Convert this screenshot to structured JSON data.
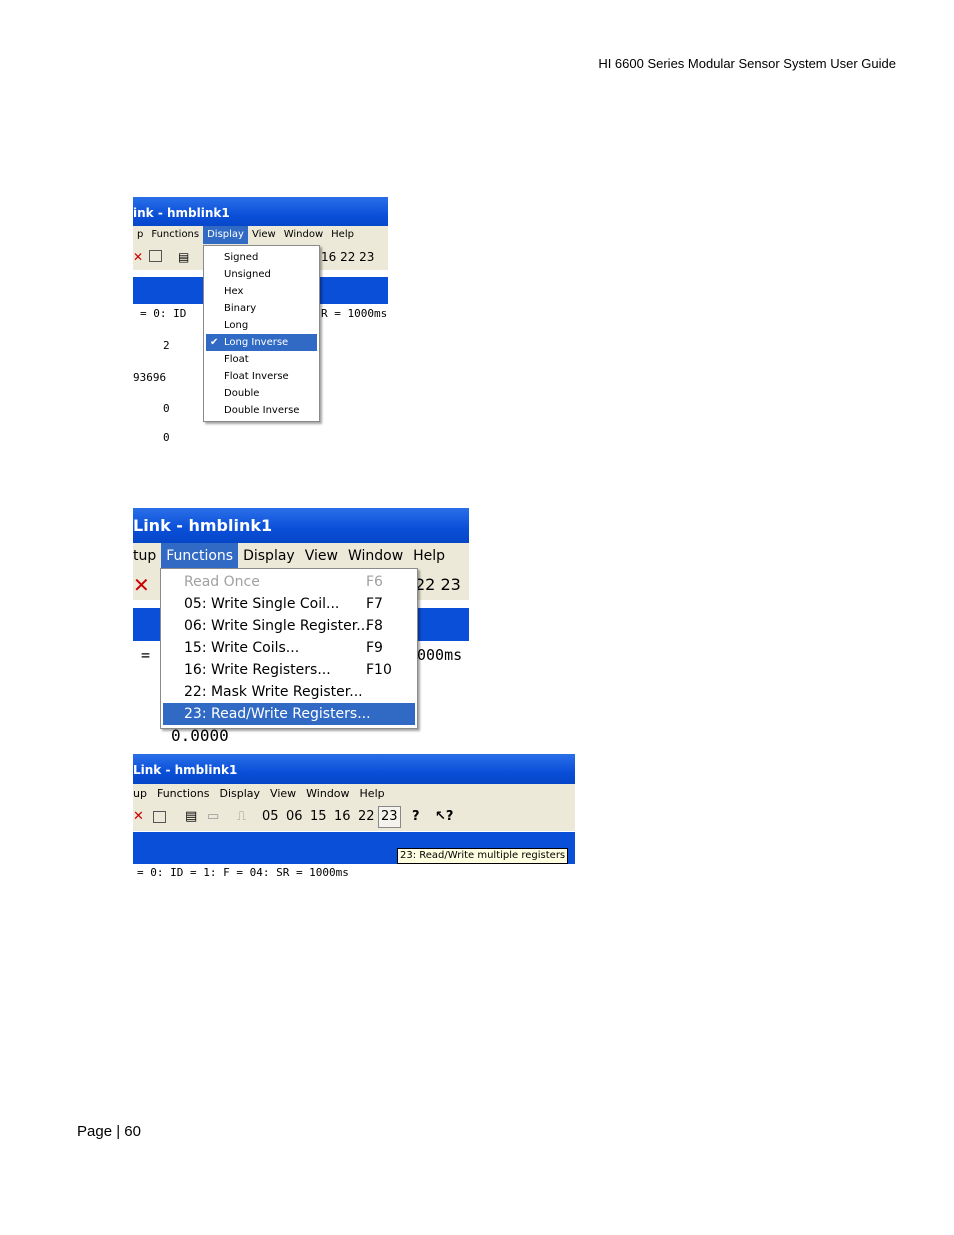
{
  "header": {
    "title": "HI 6600 Series Modular Sensor System User Guide"
  },
  "footer": {
    "page": "Page | 60"
  },
  "shot1": {
    "title": "ink - hmblink1",
    "menu": [
      "p",
      "Functions",
      "Display",
      "View",
      "Window",
      "Help"
    ],
    "toolbar_numbers": "16 22 23",
    "status_left": "= 0: ID",
    "status_right": "R = 1000ms",
    "values": [
      "2",
      "93696",
      "0",
      "0"
    ],
    "display_menu": [
      "Signed",
      "Unsigned",
      "Hex",
      "Binary",
      "Long",
      "Long Inverse",
      "Float",
      "Float Inverse",
      "Double",
      "Double Inverse"
    ],
    "selected_index": 5,
    "check_mark": "✔"
  },
  "shot2": {
    "title": "Link - hmblink1",
    "menu": [
      "tup",
      "Functions",
      "Display",
      "View",
      "Window",
      "Help"
    ],
    "toolbar_numbers": "22 23",
    "status_left": "=",
    "status_right": "000ms",
    "value": "0.0000",
    "functions_menu": [
      {
        "label": "Read Once",
        "shortcut": "F6",
        "disabled": true
      },
      {
        "label": "05: Write Single Coil...",
        "shortcut": "F7"
      },
      {
        "label": "06: Write Single Register...",
        "shortcut": "F8"
      },
      {
        "label": "15: Write Coils...",
        "shortcut": "F9"
      },
      {
        "label": "16: Write Registers...",
        "shortcut": "F10"
      },
      {
        "label": "22: Mask Write Register...",
        "shortcut": ""
      },
      {
        "label": "23: Read/Write Registers...",
        "shortcut": ""
      }
    ]
  },
  "shot3": {
    "title": "Link - hmblink1",
    "menu": [
      "up",
      "Functions",
      "Display",
      "View",
      "Window",
      "Help"
    ],
    "toolbar_numbers": [
      "05",
      "06",
      "15",
      "16",
      "22",
      "23"
    ],
    "tooltip": "23: Read/Write multiple registers",
    "status": "= 0: ID = 1: F = 04: SR = 1000ms"
  }
}
